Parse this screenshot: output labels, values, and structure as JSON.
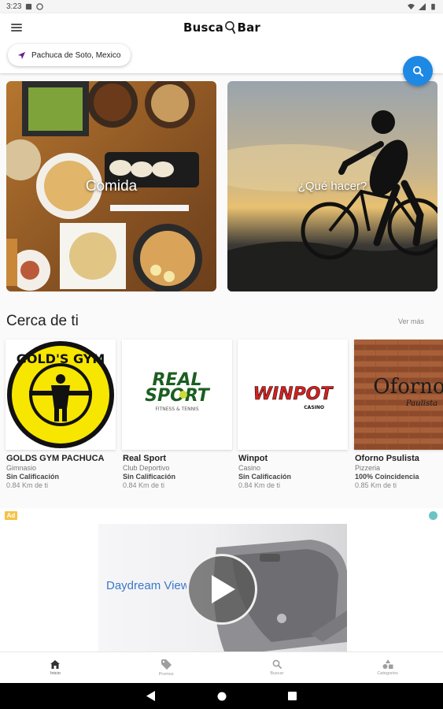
{
  "status_bar": {
    "time": "3:23"
  },
  "app": {
    "logo_left": "Busca",
    "logo_right": "Bar",
    "location_label": "Pachuca de Soto, Mexico"
  },
  "categories": [
    {
      "label": "Comida"
    },
    {
      "label": "¿Qué hacer?"
    }
  ],
  "nearby": {
    "title": "Cerca de ti",
    "see_more": "Ver más",
    "places": [
      {
        "name": "GOLDS GYM PACHUCA",
        "category": "Gimnasio",
        "rating": "Sin Calificación",
        "distance": "0.84 Km de ti",
        "logo_text": "GOLD'S GYM"
      },
      {
        "name": "Real Sport",
        "category": "Club Deportivo",
        "rating": "Sin Calificación",
        "distance": "0.84 Km de ti",
        "logo_line1": "REAL",
        "logo_line2": "SPORT",
        "logo_line3": "FITNESS & TENNIS"
      },
      {
        "name": "Winpot",
        "category": "Casino",
        "rating": "Sin Calificación",
        "distance": "0.84 Km de ti",
        "logo_text": "WINPOT",
        "logo_sub": "CASINO"
      },
      {
        "name": "Oforno Psulista",
        "category": "Pizzeria",
        "rating": "100% Coincidencia",
        "distance": "0.85 Km de ti",
        "logo_text": "Oforno",
        "logo_sub": "Paulista"
      }
    ]
  },
  "ad": {
    "badge": "Ad",
    "headline": "Daydream View"
  },
  "bottom_nav": [
    {
      "label": "Inicio",
      "icon": "home-icon",
      "active": true
    },
    {
      "label": "Promos",
      "icon": "tag-icon",
      "active": false
    },
    {
      "label": "Buscar",
      "icon": "search-icon",
      "active": false
    },
    {
      "label": "Categories",
      "icon": "categories-icon",
      "active": false
    }
  ],
  "colors": {
    "accent": "#1e88e5",
    "location_arrow": "#6a1b9a",
    "ad_badge": "#f6c244",
    "gold_yellow": "#f7e600",
    "winpot_red": "#d6201f"
  }
}
